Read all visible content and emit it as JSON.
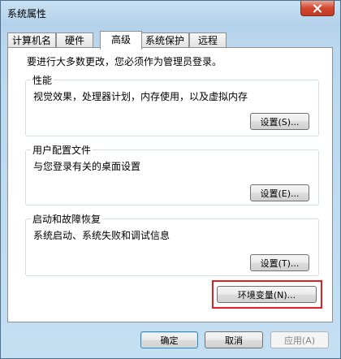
{
  "window": {
    "title": "系统属性"
  },
  "tabs": [
    {
      "label": "计算机名",
      "active": false
    },
    {
      "label": "硬件",
      "active": false
    },
    {
      "label": "高级",
      "active": true
    },
    {
      "label": "系统保护",
      "active": false
    },
    {
      "label": "远程",
      "active": false
    }
  ],
  "advanced": {
    "admin_note": "要进行大多数更改，您必须作为管理员登录。",
    "performance": {
      "title": "性能",
      "description": "视觉效果，处理器计划，内存使用，以及虚拟内存",
      "button": "设置(S)..."
    },
    "user_profiles": {
      "title": "用户配置文件",
      "description": "与您登录有关的桌面设置",
      "button": "设置(E)..."
    },
    "startup_recovery": {
      "title": "启动和故障恢复",
      "description": "系统启动、系统失败和调试信息",
      "button": "设置(T)..."
    },
    "env_vars_button": "环境变量(N)..."
  },
  "footer": {
    "ok": "确定",
    "cancel": "取消",
    "apply": "应用(A)"
  },
  "colors": {
    "highlight_border": "#e02020",
    "close_button": "#c8432a",
    "frame": "#b9d6ec"
  },
  "icons": {
    "close": "close-icon"
  }
}
